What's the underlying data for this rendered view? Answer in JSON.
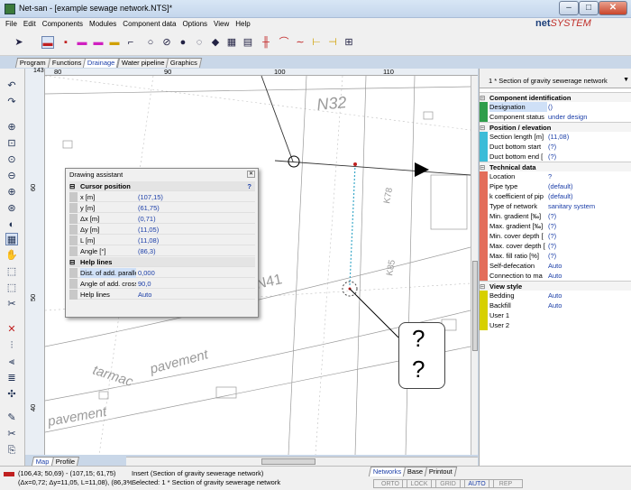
{
  "window": {
    "title": "Net-san - [example sewage network.NTS]*"
  },
  "menu": [
    "File",
    "Edit",
    "Components",
    "Modules",
    "Component data",
    "Options",
    "View",
    "Help"
  ],
  "logo": {
    "brand": "net",
    "suffix": "SYSTEM"
  },
  "top_tabs": [
    "Program",
    "Functions",
    "Drainage",
    "Water pipeline",
    "Graphics"
  ],
  "active_top_tab": "Drainage",
  "ruler": {
    "corner": "143",
    "h_labels": [
      "80",
      "90",
      "100",
      "110"
    ],
    "v_labels": [
      "60",
      "50",
      "40"
    ]
  },
  "drawing": {
    "labels": [
      "N32",
      "N41",
      "K78",
      "K85",
      "tarmac",
      "pavement",
      "pavement"
    ]
  },
  "assistant": {
    "title": "Drawing assistant",
    "help_q": "?",
    "cursor_section": "Cursor position",
    "cursor_rows": [
      {
        "label": "x [m]",
        "value": "(107,15)"
      },
      {
        "label": "y [m]",
        "value": "(61,75)"
      },
      {
        "label": "Δx [m]",
        "value": "(0,71)"
      },
      {
        "label": "Δy [m]",
        "value": "(11,05)"
      },
      {
        "label": "L [m]",
        "value": "(11,08)"
      },
      {
        "label": "Angle [°]",
        "value": "(86,3)"
      }
    ],
    "help_section": "Help lines",
    "help_rows": [
      {
        "label": "Dist. of add. parallel",
        "value": "0,000"
      },
      {
        "label": "Angle of add. cross",
        "value": "90,0"
      },
      {
        "label": "Help lines",
        "value": "Auto"
      }
    ]
  },
  "panel": {
    "title": "1 * Section of gravity sewerage network",
    "sections": [
      {
        "name": "Component identification",
        "rows": [
          {
            "label": "Designation",
            "value": "()"
          },
          {
            "label": "Component status",
            "value": "under design"
          }
        ]
      },
      {
        "name": "Position / elevation",
        "rows": [
          {
            "label": "Section length [m]",
            "value": "(11,08)"
          },
          {
            "label": "Duct bottom start",
            "value": "(?)"
          },
          {
            "label": "Duct bottom end [",
            "value": "(?)"
          }
        ]
      },
      {
        "name": "Technical data",
        "rows": [
          {
            "label": "Location",
            "value": "?"
          },
          {
            "label": "Pipe type",
            "value": "(default)"
          },
          {
            "label": "k coefficient of pip",
            "value": "(default)"
          },
          {
            "label": "Type of network",
            "value": "sanitary system"
          },
          {
            "label": "Min. gradient [‰]",
            "value": "(?)"
          },
          {
            "label": "Max. gradient [‰]",
            "value": "(?)"
          },
          {
            "label": "Min. cover depth [",
            "value": "(?)"
          },
          {
            "label": "Max. cover depth [",
            "value": "(?)"
          },
          {
            "label": "Max. fill ratio [%]",
            "value": "(?)"
          },
          {
            "label": "Self-defecation",
            "value": "Auto"
          },
          {
            "label": "Connection to ma",
            "value": "Auto"
          }
        ]
      },
      {
        "name": "View style",
        "rows": [
          {
            "label": "Bedding",
            "value": "Auto"
          },
          {
            "label": "Backfill",
            "value": "Auto"
          },
          {
            "label": "User 1",
            "value": ""
          },
          {
            "label": "User 2",
            "value": ""
          }
        ]
      }
    ]
  },
  "bottom_tabs": {
    "map": "Map",
    "profile": "Profile"
  },
  "right_bottom_tabs": [
    "Networks",
    "Base",
    "Printout"
  ],
  "status": {
    "coords1": "(106,43; 50,69) - (107,15; 61,75)",
    "coords2": "(Δx=0,72; Δy=11,05, L=11,08), (86,3%",
    "action": "Insert (Section of gravity sewerage network)",
    "selected": "Selected: 1 * Section of gravity sewerage network",
    "toggles": [
      "ORTO",
      "LOCK",
      "GRID",
      "AUTO",
      "REP"
    ],
    "active_toggle": "AUTO"
  },
  "help_bubble": [
    "?",
    "?"
  ]
}
